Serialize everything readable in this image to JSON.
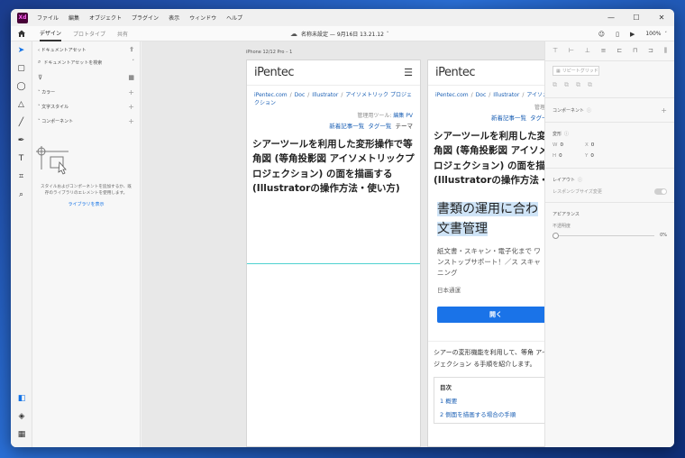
{
  "menu": [
    "ファイル",
    "編集",
    "オブジェクト",
    "プラグイン",
    "表示",
    "ウィンドウ",
    "ヘルプ"
  ],
  "window_controls": {
    "minimize": "—",
    "maximize": "☐",
    "close": "✕"
  },
  "appbar": {
    "tabs": [
      "デザイン",
      "プロトタイプ",
      "共有"
    ],
    "doc_title": "名称未設定 — 9月16日 13.21.12",
    "zoom": "100%"
  },
  "assets": {
    "header": "ドキュメントアセット",
    "search_placeholder": "ドキュメントアセットを検索",
    "sections": [
      "カラー",
      "文字スタイル",
      "コンポーネント"
    ],
    "empty_text": "スタイルおよびコンポーネントを追加するか、既存のライブラリのエレメントを使用します。",
    "empty_link": "ライブラリを表示"
  },
  "canvas": {
    "artboard_label": "iPhone 12/12 Pro – 1",
    "logo": "iPentec",
    "breadcrumb": [
      "iPentec.com",
      "Doc",
      "Illustrator",
      "アイソメトリック プロジェクション"
    ],
    "tools_label": "管理用ツール:",
    "tools_links": [
      "編集",
      "PV"
    ],
    "nav_links": [
      "新着記事一覧",
      "タグ一覧"
    ],
    "nav_plain": "テーマ",
    "article_title": "シアーツールを利用した変形操作で等角図 (等角投影図 アイソメトリックプロジェクション) の面を描画する (Illustratorの操作方法・使い方)",
    "ad_title_line1": "書類の運用に合わ",
    "ad_title_line2": "文書管理",
    "ad_sub": "紙文書・スキャン・電子化まで ワンストップサポート！／ス スキャニング",
    "ad_source": "日本通運",
    "ad_button": "開く",
    "intro": "シアーの変形機能を利用して、等角 アイソメトリック プロジェクション る手順を紹介します。",
    "toc_title": "目次",
    "toc_items": [
      "1 概要",
      "2 側面を描画する場合の手順"
    ]
  },
  "props": {
    "repeat_grid": "リピートグリッド",
    "component": "コンポーネント",
    "transform": "変形",
    "x_label": "X",
    "x_value": "0",
    "y_label": "Y",
    "y_value": "0",
    "w_label": "W",
    "w_value": "0",
    "h_label": "H",
    "h_value": "0",
    "layout": "レイアウト",
    "responsive": "レスポンシブサイズ変更",
    "appearance": "アピアランス",
    "opacity_label": "不透明度",
    "opacity_value": "0%"
  },
  "colors": {
    "accent": "#1473e6",
    "link": "#1a5fb4",
    "brand": "#470137"
  }
}
